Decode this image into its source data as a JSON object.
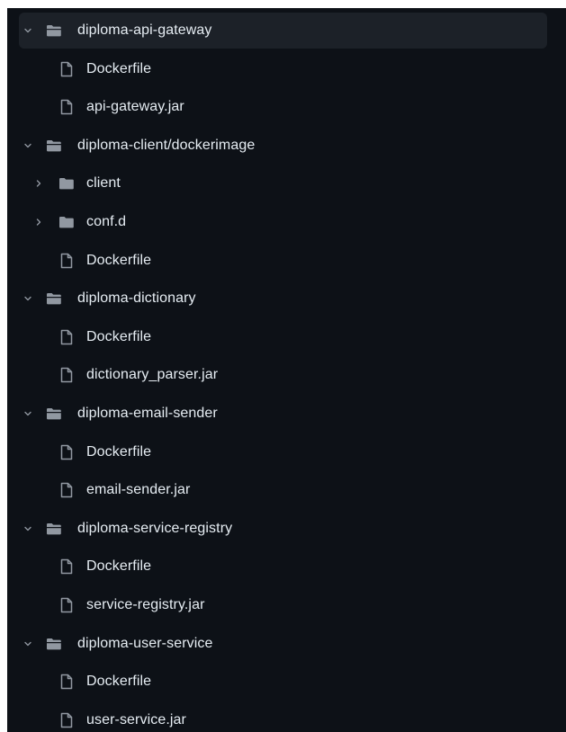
{
  "tree": [
    {
      "kind": "folder",
      "expanded": true,
      "label": "diploma-api-gateway",
      "selected": true,
      "depth": 0
    },
    {
      "kind": "file",
      "label": "Dockerfile",
      "depth": 1
    },
    {
      "kind": "file",
      "label": "api-gateway.jar",
      "depth": 1
    },
    {
      "kind": "folder",
      "expanded": true,
      "label": "diploma-client/dockerimage",
      "depth": 0
    },
    {
      "kind": "folder",
      "expanded": false,
      "label": "client",
      "depth": 1
    },
    {
      "kind": "folder",
      "expanded": false,
      "label": "conf.d",
      "depth": 1
    },
    {
      "kind": "file",
      "label": "Dockerfile",
      "depth": 1
    },
    {
      "kind": "folder",
      "expanded": true,
      "label": "diploma-dictionary",
      "depth": 0
    },
    {
      "kind": "file",
      "label": "Dockerfile",
      "depth": 1
    },
    {
      "kind": "file",
      "label": "dictionary_parser.jar",
      "depth": 1
    },
    {
      "kind": "folder",
      "expanded": true,
      "label": "diploma-email-sender",
      "depth": 0
    },
    {
      "kind": "file",
      "label": "Dockerfile",
      "depth": 1
    },
    {
      "kind": "file",
      "label": "email-sender.jar",
      "depth": 1
    },
    {
      "kind": "folder",
      "expanded": true,
      "label": "diploma-service-registry",
      "depth": 0
    },
    {
      "kind": "file",
      "label": "Dockerfile",
      "depth": 1
    },
    {
      "kind": "file",
      "label": "service-registry.jar",
      "depth": 1
    },
    {
      "kind": "folder",
      "expanded": true,
      "label": "diploma-user-service",
      "depth": 0
    },
    {
      "kind": "file",
      "label": "Dockerfile",
      "depth": 1
    },
    {
      "kind": "file",
      "label": "user-service.jar",
      "depth": 1
    }
  ],
  "colors": {
    "background": "#0d1117",
    "selected_row": "#1c2128",
    "text": "#e6edf3",
    "icon": "#9198a1"
  }
}
